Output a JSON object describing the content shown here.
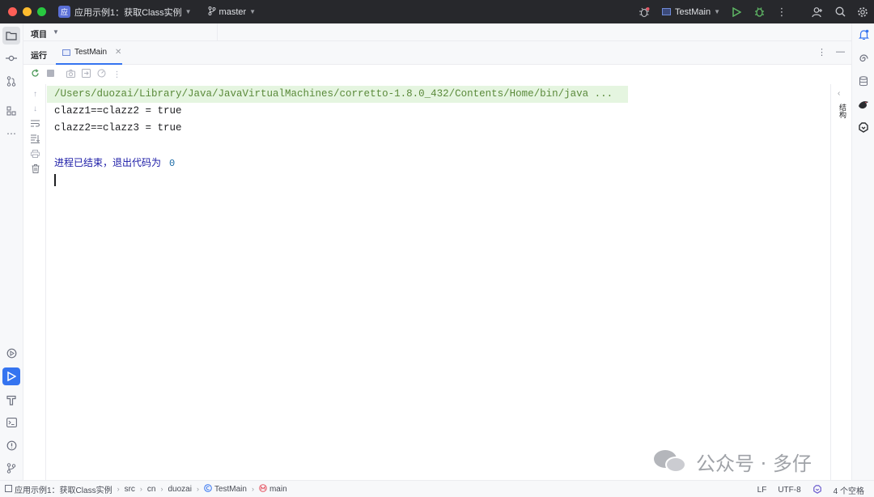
{
  "titlebar": {
    "project_badge": "应",
    "project_name": "应用示例1：获取Class实例",
    "branch": "master",
    "run_config": "TestMain"
  },
  "project_panel": {
    "label": "项目"
  },
  "run_panel": {
    "label": "运行",
    "tab": "TestMain"
  },
  "console": {
    "command": "/Users/duozai/Library/Java/JavaVirtualMachines/corretto-1.8.0_432/Contents/Home/bin/java ...",
    "lines": [
      "clazz1==clazz2 = true",
      "clazz2==clazz3 = true"
    ],
    "exit_text": "进程已结束，退出代码为",
    "exit_code": "0"
  },
  "right_side_label": "结构",
  "statusbar": {
    "crumbs": [
      "应用示例1：获取Class实例",
      "src",
      "cn",
      "duozai",
      "TestMain",
      "main"
    ],
    "line_ending": "LF",
    "encoding": "UTF-8",
    "indent": "4 个空格"
  },
  "watermark": {
    "text": "公众号 · 多仔"
  },
  "colors": {
    "accent": "#3574f0",
    "titlebar_bg": "#27282c",
    "command_bg": "#e5f5e0",
    "exit_text": "#1a1aa6"
  },
  "icons": {
    "left": [
      "folder-icon",
      "commit-icon",
      "pull-request-icon",
      "structure-icon",
      "more-icon",
      "services-icon",
      "run-icon",
      "build-icon",
      "terminal-icon",
      "problems-icon",
      "git-icon"
    ],
    "right": [
      "notifications-icon",
      "ai-assistant-icon",
      "database-icon",
      "plugin-icon",
      "copilot-icon"
    ]
  }
}
